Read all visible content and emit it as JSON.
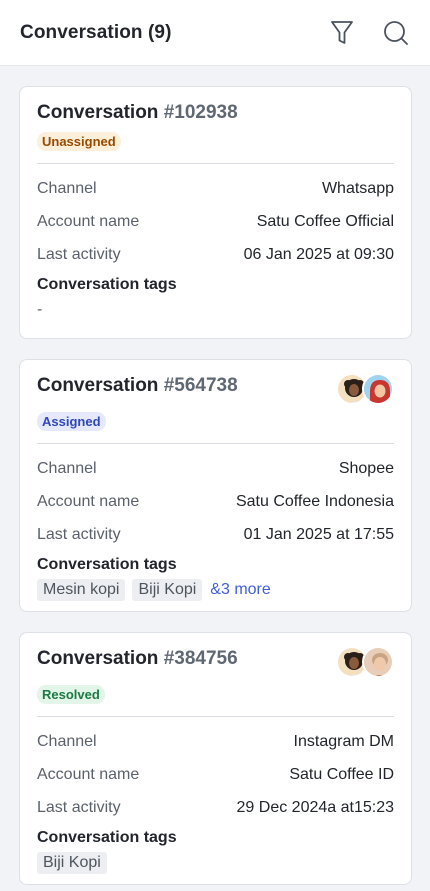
{
  "header": {
    "title": "Conversation (9)",
    "filter_icon": "filter-icon",
    "search_icon": "search-icon"
  },
  "labels": {
    "channel": "Channel",
    "account_name": "Account name",
    "last_activity": "Last activity",
    "tags_title": "Conversation tags"
  },
  "conversations": [
    {
      "title": "Conversation",
      "number": "#102938",
      "status": "Unassigned",
      "status_color": "#9a4a00",
      "status_bg": "#fdf0da",
      "channel": "Whatsapp",
      "account_name": "Satu Coffee Official",
      "last_activity": "06 Jan 2025 at 09:30",
      "tags_empty": "-",
      "tags": []
    },
    {
      "title": "Conversation",
      "number": "#564738",
      "status": "Assigned",
      "status_color": "#3049b7",
      "status_bg": "#e5e9fb",
      "channel": "Shopee",
      "account_name": "Satu Coffee Indonesia",
      "last_activity": "01 Jan 2025 at 17:55",
      "tags": [
        "Mesin kopi",
        "Biji Kopi"
      ],
      "more": "&3 more"
    },
    {
      "title": "Conversation",
      "number": "#384756",
      "status": "Resolved",
      "status_color": "#1d7a43",
      "status_bg": "#e3f4e8",
      "channel": "Instagram DM",
      "account_name": "Satu Coffee ID",
      "last_activity": "29 Dec 2024a at15:23",
      "tags": [
        "Biji Kopi"
      ]
    }
  ]
}
